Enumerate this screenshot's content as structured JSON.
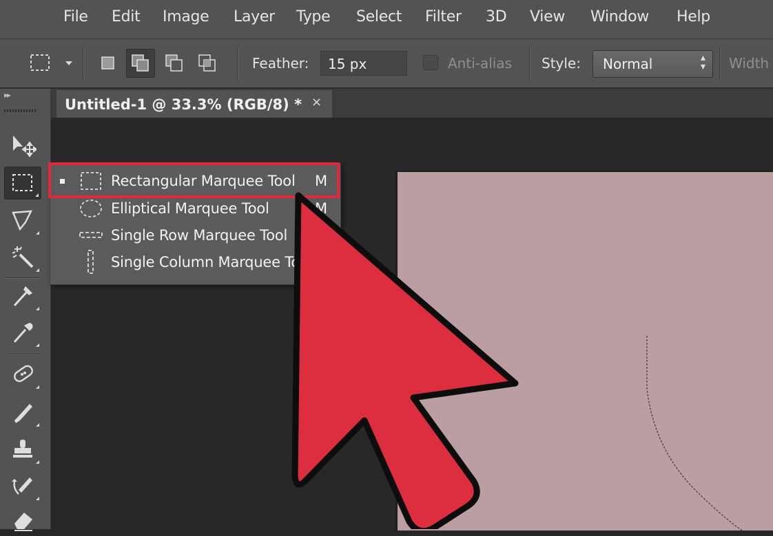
{
  "menubar": {
    "items": [
      {
        "label": "File"
      },
      {
        "label": "Edit"
      },
      {
        "label": "Image"
      },
      {
        "label": "Layer"
      },
      {
        "label": "Type"
      },
      {
        "label": "Select"
      },
      {
        "label": "Filter"
      },
      {
        "label": "3D"
      },
      {
        "label": "View"
      },
      {
        "label": "Window"
      },
      {
        "label": "Help"
      }
    ]
  },
  "options": {
    "feather_label": "Feather:",
    "feather_value": "15 px",
    "antialias_label": "Anti-alias",
    "style_label": "Style:",
    "style_value": "Normal",
    "width_label": "Width"
  },
  "document": {
    "tab_title": "Untitled-1 @ 33.3% (RGB/8) *",
    "close_glyph": "×",
    "canvas_color": "#bb9ea1"
  },
  "flyout": {
    "items": [
      {
        "label": "Rectangular Marquee Tool",
        "shortcut": "M",
        "icon": "rectangular-marquee-icon",
        "selected": true
      },
      {
        "label": "Elliptical Marquee Tool",
        "shortcut": "M",
        "icon": "elliptical-marquee-icon"
      },
      {
        "label": "Single Row Marquee Tool",
        "shortcut": "",
        "icon": "single-row-marquee-icon"
      },
      {
        "label": "Single Column Marquee Tool",
        "shortcut": "",
        "icon": "single-column-marquee-icon"
      }
    ]
  },
  "toolbox": {
    "tools": [
      {
        "icon": "move-tool-icon"
      },
      {
        "icon": "rectangular-marquee-icon",
        "active": true
      },
      {
        "icon": "lasso-tool-icon"
      },
      {
        "icon": "magic-wand-icon"
      },
      {
        "icon": "crop-tool-icon"
      },
      {
        "icon": "eyedropper-icon"
      },
      {
        "icon": "healing-brush-icon"
      },
      {
        "icon": "brush-tool-icon"
      },
      {
        "icon": "clone-stamp-icon"
      },
      {
        "icon": "history-brush-icon"
      },
      {
        "icon": "eraser-icon"
      }
    ]
  },
  "annotation": {
    "highlight_color": "#e0283f",
    "arrow_color": "#dc2e3f"
  }
}
